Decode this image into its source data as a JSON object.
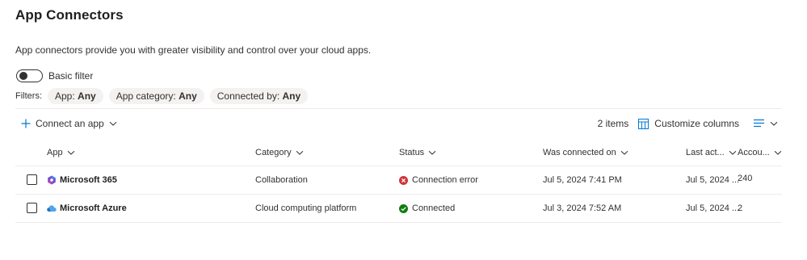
{
  "page": {
    "title": "App Connectors",
    "description": "App connectors provide you with greater visibility and control over your cloud apps."
  },
  "filter_toggle": {
    "label": "Basic filter",
    "on": false
  },
  "filters": {
    "label": "Filters:",
    "pills": [
      {
        "name": "App:",
        "value": "Any"
      },
      {
        "name": "App category:",
        "value": "Any"
      },
      {
        "name": "Connected by:",
        "value": "Any"
      }
    ]
  },
  "commands": {
    "connect_app": "Connect an app",
    "items_count": "2 items",
    "customize_columns": "Customize columns"
  },
  "table": {
    "columns": [
      "App",
      "Category",
      "Status",
      "Was connected on",
      "Last act...",
      "Accou..."
    ],
    "rows": [
      {
        "app": "Microsoft 365",
        "app_icon": "microsoft-365-icon",
        "category": "Collaboration",
        "status": "Connection error",
        "status_icon": "error-circle-icon",
        "connected_on": "Jul 5, 2024 7:41 PM",
        "last_activity": "Jul 5, 2024 ...",
        "accounts": "240"
      },
      {
        "app": "Microsoft Azure",
        "app_icon": "microsoft-azure-icon",
        "category": "Cloud computing platform",
        "status": "Connected",
        "status_icon": "success-circle-icon",
        "connected_on": "Jul 3, 2024 7:52 AM",
        "last_activity": "Jul 5, 2024 ...",
        "accounts": "2"
      }
    ]
  },
  "colors": {
    "accent": "#0078d4",
    "error": "#d13438",
    "success": "#107c10",
    "divider": "#edebe9",
    "pill_bg": "#f3f2f1"
  }
}
